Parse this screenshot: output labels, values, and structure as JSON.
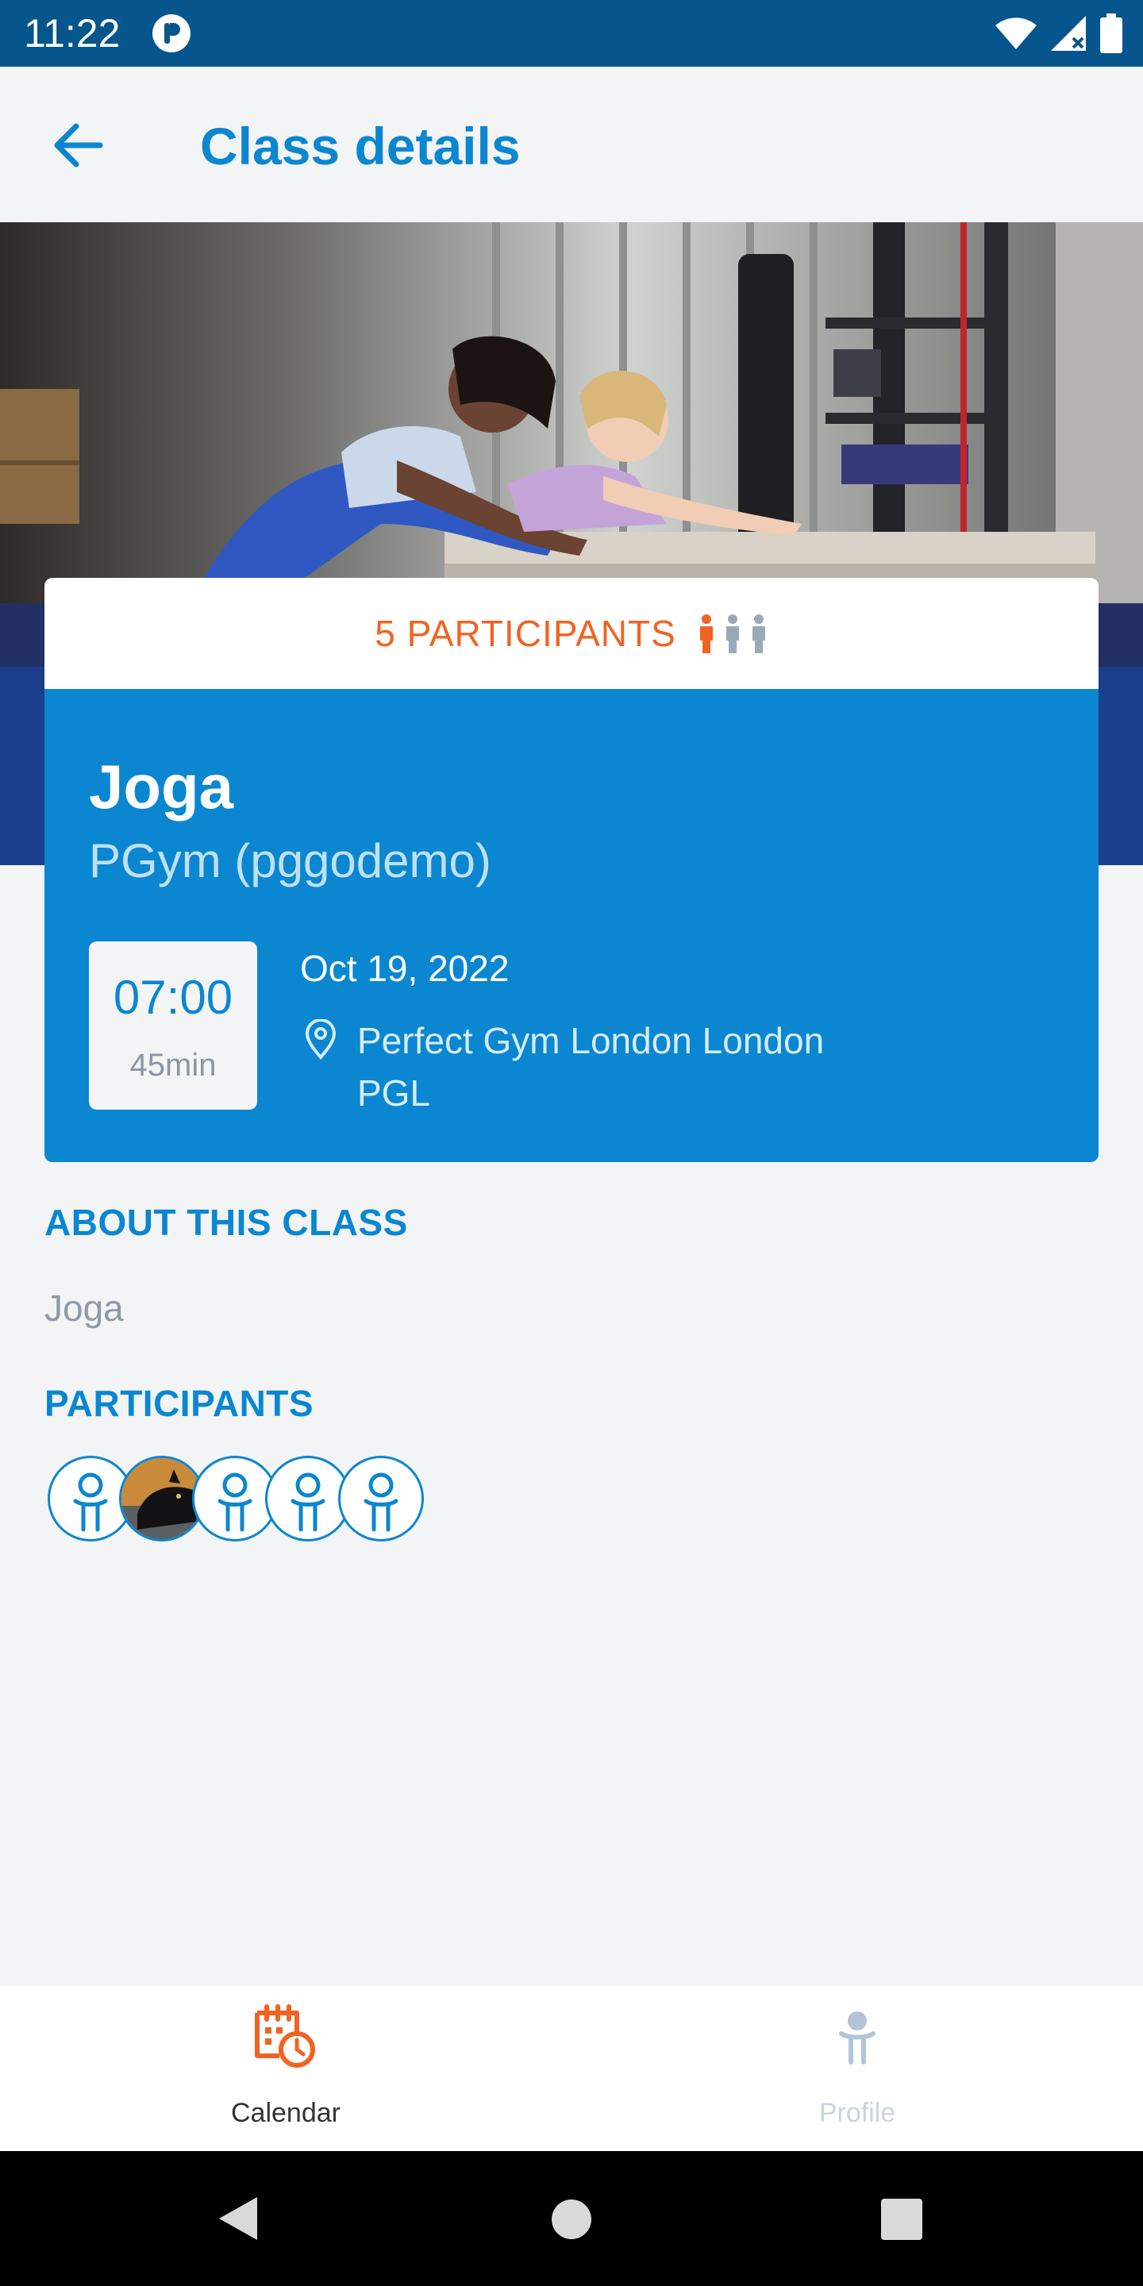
{
  "status_bar": {
    "time": "11:22"
  },
  "toolbar": {
    "title": "Class details"
  },
  "card": {
    "participants_label": "5 PARTICIPANTS",
    "class_name": "Joga",
    "club": "PGym (pggodemo)",
    "start_time": "07:00",
    "duration": "45min",
    "date": "Oct 19, 2022",
    "location_line1": "Perfect Gym London London",
    "location_line2": "PGL"
  },
  "about": {
    "heading": "ABOUT THIS CLASS",
    "text": "Joga"
  },
  "participants": {
    "heading": "PARTICIPANTS",
    "count": 5
  },
  "bottom_nav": {
    "calendar": "Calendar",
    "profile": "Profile"
  },
  "colors": {
    "primary": "#0a87d0",
    "accent": "#f06423",
    "status_bar": "#06558c"
  }
}
